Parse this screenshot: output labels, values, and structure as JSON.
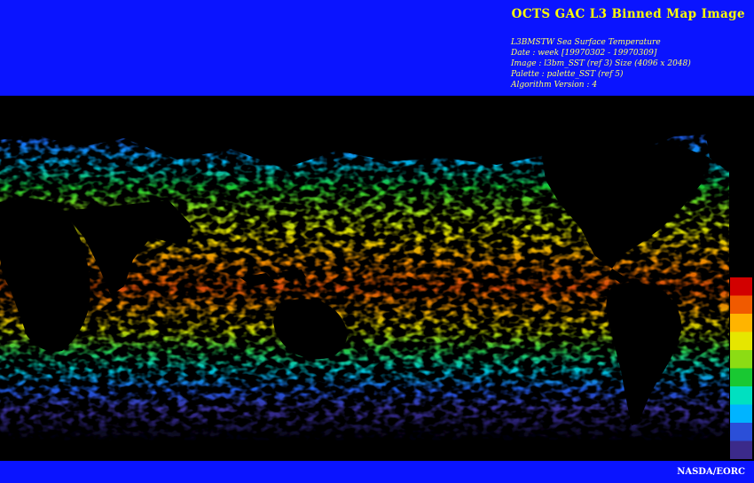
{
  "header": {
    "title": "OCTS GAC L3 Binned Map Image",
    "meta": [
      "L3BMSTW Sea Surface Temperature",
      "Date : week [19970302 - 19970309]",
      "Image : l3bm_SST (ref 3) Size (4096 x 2048)",
      "Palette : palette_SST (ref 5)",
      "Algorithm Version : 4"
    ]
  },
  "footer": {
    "credit": "NASDA/EORC"
  },
  "colors": {
    "banner": "#0a14ff",
    "title_text": "#ffff00",
    "land_background": "#000000"
  },
  "palette": [
    "#3b2a8a",
    "#2b4fd8",
    "#00b4ff",
    "#00e0c0",
    "#19c832",
    "#8cdc14",
    "#e6e600",
    "#ffb400",
    "#f05a00",
    "#d20000"
  ],
  "map": {
    "projection": "equirectangular",
    "variable": "sea surface temperature"
  }
}
